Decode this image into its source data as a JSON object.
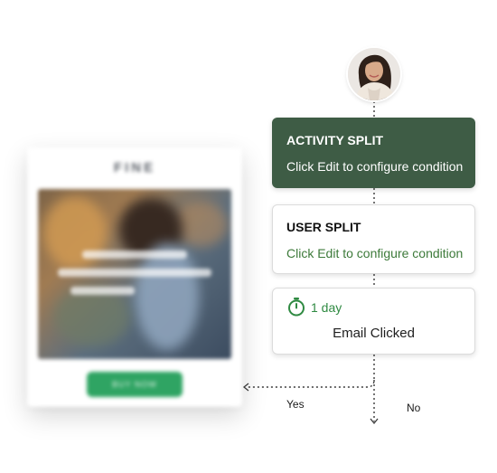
{
  "email_preview": {
    "logo": "FINE",
    "button_label": "BUY NOW"
  },
  "flow": {
    "activity_split": {
      "title": "ACTIVITY SPLIT",
      "description": "Click Edit to configure condition"
    },
    "user_split": {
      "title": "USER SPLIT",
      "description": "Click Edit to configure condition"
    },
    "wait_step": {
      "icon": "stopwatch-icon",
      "duration": "1 day",
      "event": "Email Clicked"
    },
    "branches": {
      "yes_label": "Yes",
      "no_label": "No"
    }
  },
  "colors": {
    "activity_split_bg": "#3e5c45",
    "accent_green": "#2f8a42",
    "user_split_desc": "#3d7a3a",
    "preview_button": "#2fa463"
  }
}
